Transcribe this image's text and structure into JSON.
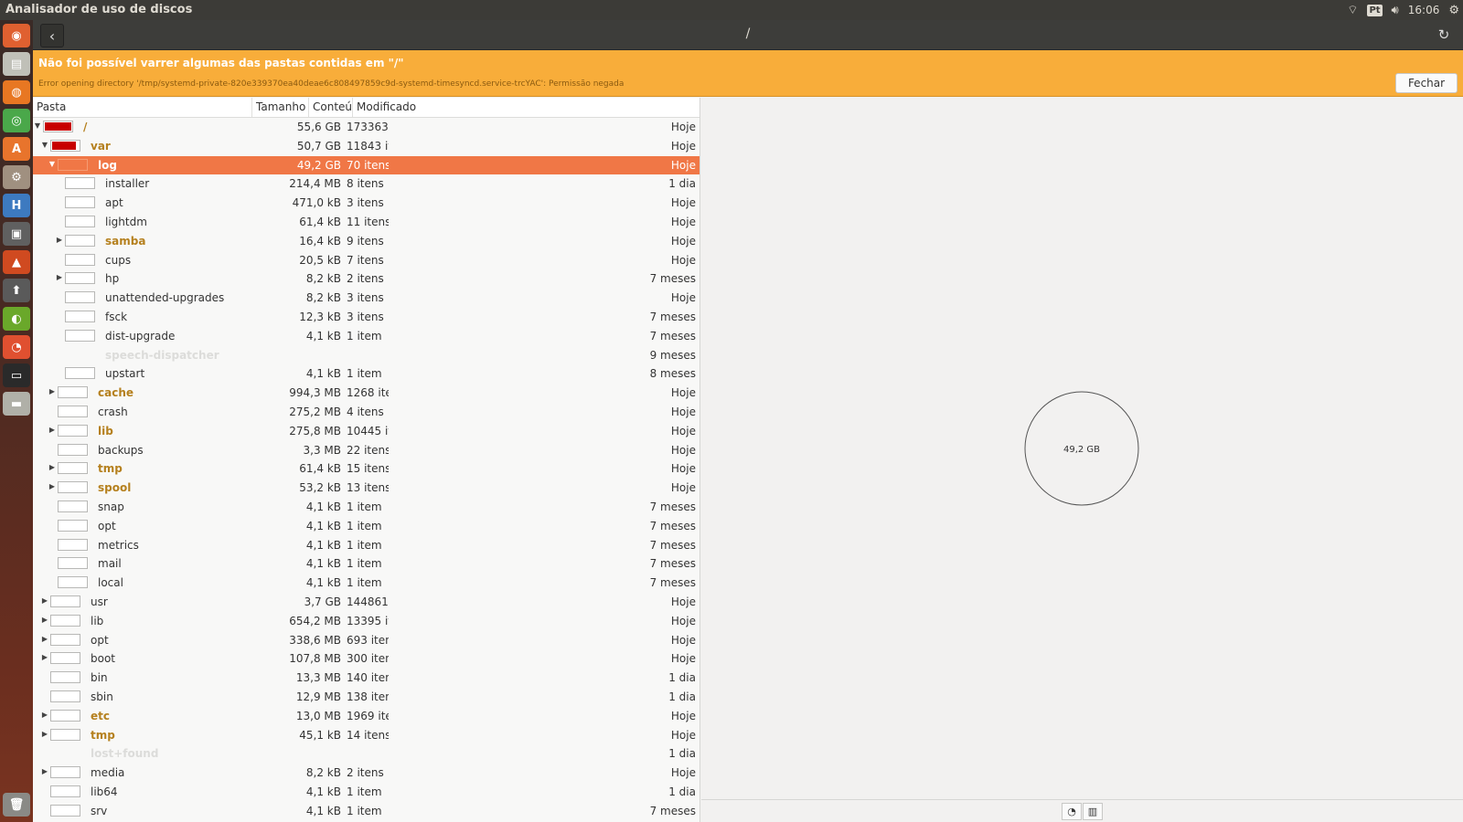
{
  "topbar": {
    "title": "Analisador de uso de discos",
    "keyboard": "Pt",
    "clock": "16:06"
  },
  "launcher": {
    "items": [
      {
        "icon": "dash-icon",
        "glyph": "◉",
        "color": "#e06030"
      },
      {
        "icon": "files-icon",
        "glyph": "▤",
        "color": "#c0c0b8"
      },
      {
        "icon": "firefox-icon",
        "glyph": "◍",
        "color": "#e87722"
      },
      {
        "icon": "chrome-icon",
        "glyph": "◎",
        "color": "#4aa84a"
      },
      {
        "icon": "software-center-icon",
        "glyph": "A",
        "color": "#e8742c"
      },
      {
        "icon": "settings-icon",
        "glyph": "⚙",
        "color": "#a09080"
      },
      {
        "icon": "hexchat-icon",
        "glyph": "H",
        "color": "#3d7ac0"
      },
      {
        "icon": "media-icon",
        "glyph": "▣",
        "color": "#606060"
      },
      {
        "icon": "synaptic-icon",
        "glyph": "▲",
        "color": "#d04a20"
      },
      {
        "icon": "update-icon",
        "glyph": "⬆",
        "color": "#5a5a5a"
      },
      {
        "icon": "nvidia-icon",
        "glyph": "◐",
        "color": "#6aa82a"
      },
      {
        "icon": "disk-analyzer-icon",
        "glyph": "◔",
        "color": "#e05030"
      },
      {
        "icon": "terminal-icon",
        "glyph": "▭",
        "color": "#2a2a2a"
      },
      {
        "icon": "drive-icon",
        "glyph": "▬",
        "color": "#b0b0a8"
      }
    ],
    "trash_icon": "trash-icon"
  },
  "header": {
    "path": "/"
  },
  "infobar": {
    "message": "Não foi possível varrer algumas das pastas contidas em \"/\"",
    "detail": "Error opening directory '/tmp/systemd-private-820e339370ea40deae6c808497859c9d-systemd-timesyncd.service-trcYAC': Permissão negada",
    "close_label": "Fechar"
  },
  "columns": {
    "folder": "Pasta",
    "size": "Tamanho",
    "contents": "Conteú",
    "modified": "Modificado"
  },
  "rows": [
    {
      "name": "/",
      "size": "55,6 GB",
      "count": "173363 i",
      "mod": "Hoje",
      "level": 0,
      "arrow": "down",
      "fill": 1.0,
      "bold": true,
      "sel": false
    },
    {
      "name": "var",
      "size": "50,7 GB",
      "count": "11843 it",
      "mod": "Hoje",
      "level": 1,
      "arrow": "down",
      "fill": 0.91,
      "bold": true,
      "sel": false
    },
    {
      "name": "log",
      "size": "49,2 GB",
      "count": "70 itens",
      "mod": "Hoje",
      "level": 2,
      "arrow": "down",
      "fill": 0.97,
      "bold": true,
      "sel": true
    },
    {
      "name": "installer",
      "size": "214,4 MB",
      "count": "8 itens",
      "mod": "1 dia",
      "level": 3,
      "arrow": "",
      "fill": 0.0,
      "bold": false,
      "sel": false
    },
    {
      "name": "apt",
      "size": "471,0 kB",
      "count": "3 itens",
      "mod": "Hoje",
      "level": 3,
      "arrow": "",
      "fill": 0.0,
      "bold": false,
      "sel": false
    },
    {
      "name": "lightdm",
      "size": "61,4 kB",
      "count": "11 itens",
      "mod": "Hoje",
      "level": 3,
      "arrow": "",
      "fill": 0.0,
      "bold": false,
      "sel": false
    },
    {
      "name": "samba",
      "size": "16,4 kB",
      "count": "9 itens",
      "mod": "Hoje",
      "level": 3,
      "arrow": "right",
      "fill": 0.0,
      "bold": true,
      "sel": false
    },
    {
      "name": "cups",
      "size": "20,5 kB",
      "count": "7 itens",
      "mod": "Hoje",
      "level": 3,
      "arrow": "",
      "fill": 0.0,
      "bold": false,
      "sel": false
    },
    {
      "name": "hp",
      "size": "8,2 kB",
      "count": "2 itens",
      "mod": "7 meses",
      "level": 3,
      "arrow": "right",
      "fill": 0.0,
      "bold": false,
      "sel": false
    },
    {
      "name": "unattended-upgrades",
      "size": "8,2 kB",
      "count": "3 itens",
      "mod": "Hoje",
      "level": 3,
      "arrow": "",
      "fill": 0.0,
      "bold": false,
      "sel": false
    },
    {
      "name": "fsck",
      "size": "12,3 kB",
      "count": "3 itens",
      "mod": "7 meses",
      "level": 3,
      "arrow": "",
      "fill": 0.0,
      "bold": false,
      "sel": false
    },
    {
      "name": "dist-upgrade",
      "size": "4,1 kB",
      "count": "1 item",
      "mod": "7 meses",
      "level": 3,
      "arrow": "",
      "fill": 0.0,
      "bold": false,
      "sel": false
    },
    {
      "name": "speech-dispatcher",
      "size": "",
      "count": "",
      "mod": "9 meses",
      "level": 3,
      "arrow": "",
      "fill": 0.0,
      "bold": false,
      "sel": false,
      "dim": true
    },
    {
      "name": "upstart",
      "size": "4,1 kB",
      "count": "1 item",
      "mod": "8 meses",
      "level": 3,
      "arrow": "",
      "fill": 0.0,
      "bold": false,
      "sel": false
    },
    {
      "name": "cache",
      "size": "994,3 MB",
      "count": "1268 ite",
      "mod": "Hoje",
      "level": 2,
      "arrow": "right",
      "fill": 0.0,
      "bold": true,
      "sel": false
    },
    {
      "name": "crash",
      "size": "275,2 MB",
      "count": "4 itens",
      "mod": "Hoje",
      "level": 2,
      "arrow": "",
      "fill": 0.0,
      "bold": false,
      "sel": false
    },
    {
      "name": "lib",
      "size": "275,8 MB",
      "count": "10445 it",
      "mod": "Hoje",
      "level": 2,
      "arrow": "right",
      "fill": 0.0,
      "bold": true,
      "sel": false
    },
    {
      "name": "backups",
      "size": "3,3 MB",
      "count": "22 itens",
      "mod": "Hoje",
      "level": 2,
      "arrow": "",
      "fill": 0.0,
      "bold": false,
      "sel": false
    },
    {
      "name": "tmp",
      "size": "61,4 kB",
      "count": "15 itens",
      "mod": "Hoje",
      "level": 2,
      "arrow": "right",
      "fill": 0.0,
      "bold": true,
      "sel": false
    },
    {
      "name": "spool",
      "size": "53,2 kB",
      "count": "13 itens",
      "mod": "Hoje",
      "level": 2,
      "arrow": "right",
      "fill": 0.0,
      "bold": true,
      "sel": false
    },
    {
      "name": "snap",
      "size": "4,1 kB",
      "count": "1 item",
      "mod": "7 meses",
      "level": 2,
      "arrow": "",
      "fill": 0.0,
      "bold": false,
      "sel": false
    },
    {
      "name": "opt",
      "size": "4,1 kB",
      "count": "1 item",
      "mod": "7 meses",
      "level": 2,
      "arrow": "",
      "fill": 0.0,
      "bold": false,
      "sel": false
    },
    {
      "name": "metrics",
      "size": "4,1 kB",
      "count": "1 item",
      "mod": "7 meses",
      "level": 2,
      "arrow": "",
      "fill": 0.0,
      "bold": false,
      "sel": false
    },
    {
      "name": "mail",
      "size": "4,1 kB",
      "count": "1 item",
      "mod": "7 meses",
      "level": 2,
      "arrow": "",
      "fill": 0.0,
      "bold": false,
      "sel": false
    },
    {
      "name": "local",
      "size": "4,1 kB",
      "count": "1 item",
      "mod": "7 meses",
      "level": 2,
      "arrow": "",
      "fill": 0.0,
      "bold": false,
      "sel": false
    },
    {
      "name": "usr",
      "size": "3,7 GB",
      "count": "144861 i",
      "mod": "Hoje",
      "level": 1,
      "arrow": "right",
      "fill": 0.0,
      "bold": false,
      "sel": false
    },
    {
      "name": "lib",
      "size": "654,2 MB",
      "count": "13395 it",
      "mod": "Hoje",
      "level": 1,
      "arrow": "right",
      "fill": 0.0,
      "bold": false,
      "sel": false
    },
    {
      "name": "opt",
      "size": "338,6 MB",
      "count": "693 iten",
      "mod": "Hoje",
      "level": 1,
      "arrow": "right",
      "fill": 0.0,
      "bold": false,
      "sel": false
    },
    {
      "name": "boot",
      "size": "107,8 MB",
      "count": "300 iten",
      "mod": "Hoje",
      "level": 1,
      "arrow": "right",
      "fill": 0.0,
      "bold": false,
      "sel": false
    },
    {
      "name": "bin",
      "size": "13,3 MB",
      "count": "140 iten",
      "mod": "1 dia",
      "level": 1,
      "arrow": "",
      "fill": 0.0,
      "bold": false,
      "sel": false
    },
    {
      "name": "sbin",
      "size": "12,9 MB",
      "count": "138 iten",
      "mod": "1 dia",
      "level": 1,
      "arrow": "",
      "fill": 0.0,
      "bold": false,
      "sel": false
    },
    {
      "name": "etc",
      "size": "13,0 MB",
      "count": "1969 ite",
      "mod": "Hoje",
      "level": 1,
      "arrow": "right",
      "fill": 0.0,
      "bold": true,
      "sel": false
    },
    {
      "name": "tmp",
      "size": "45,1 kB",
      "count": "14 itens",
      "mod": "Hoje",
      "level": 1,
      "arrow": "right",
      "fill": 0.0,
      "bold": true,
      "sel": false
    },
    {
      "name": "lost+found",
      "size": "",
      "count": "",
      "mod": "1 dia",
      "level": 1,
      "arrow": "",
      "fill": 0.0,
      "bold": false,
      "sel": false,
      "dim": true
    },
    {
      "name": "media",
      "size": "8,2 kB",
      "count": "2 itens",
      "mod": "Hoje",
      "level": 1,
      "arrow": "right",
      "fill": 0.0,
      "bold": false,
      "sel": false
    },
    {
      "name": "lib64",
      "size": "4,1 kB",
      "count": "1 item",
      "mod": "1 dia",
      "level": 1,
      "arrow": "",
      "fill": 0.0,
      "bold": false,
      "sel": false
    },
    {
      "name": "srv",
      "size": "4,1 kB",
      "count": "1 item",
      "mod": "7 meses",
      "level": 1,
      "arrow": "",
      "fill": 0.0,
      "bold": false,
      "sel": false
    }
  ],
  "chart": {
    "center_label": "49,2 GB"
  },
  "colors": {
    "accent": "#f07746",
    "fill": "#c80000",
    "warning": "#f8ad3a"
  }
}
